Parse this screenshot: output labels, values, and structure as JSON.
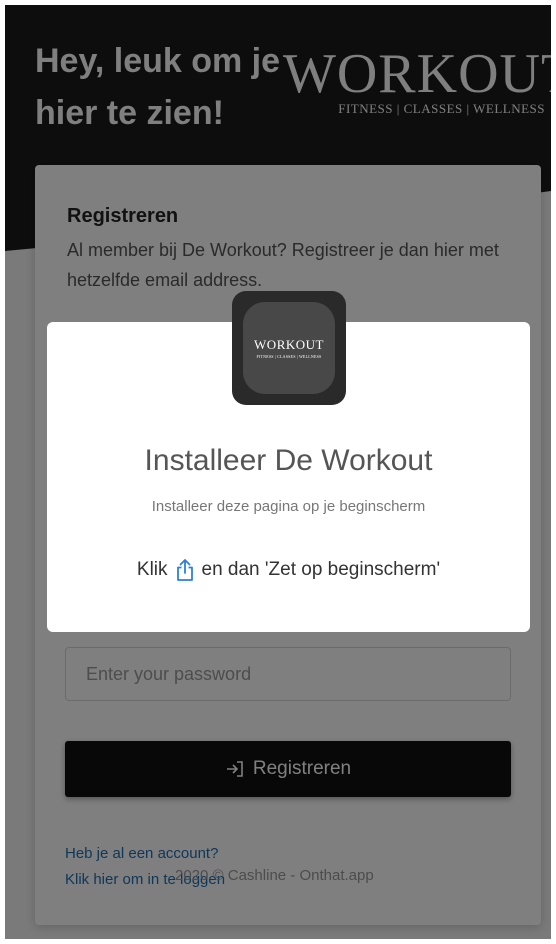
{
  "header": {
    "greeting": "Hey, leuk om je hier te zien!",
    "brand_name": "WORKOUT",
    "brand_tagline": "FITNESS | CLASSES | WELLNESS"
  },
  "register": {
    "title": "Registreren",
    "description": "Al member bij De Workout? Registreer je dan hier met hetzelfde email address.",
    "password_placeholder": "Enter your password",
    "button_label": "Registreren",
    "button_icon": "login-arrow-icon",
    "login_prompt": "Heb je al een account?",
    "login_link": "Klik hier om in te loggen",
    "footer": "2020 © Cashline - Onthat.app"
  },
  "install_dialog": {
    "app_icon_name": "WORKOUT",
    "app_icon_tagline": "FITNESS | CLASSES | WELLNESS",
    "title": "Installeer De Workout",
    "subtitle": "Installeer deze pagina op je beginscherm",
    "instruction_before": "Klik",
    "instruction_icon": "share-icon",
    "instruction_after": "en dan 'Zet op beginscherm'"
  },
  "colors": {
    "header_background": "#1b1b1b",
    "button_background": "#111111",
    "link": "#1f6fb2",
    "share_icon": "#2f7fd8"
  }
}
